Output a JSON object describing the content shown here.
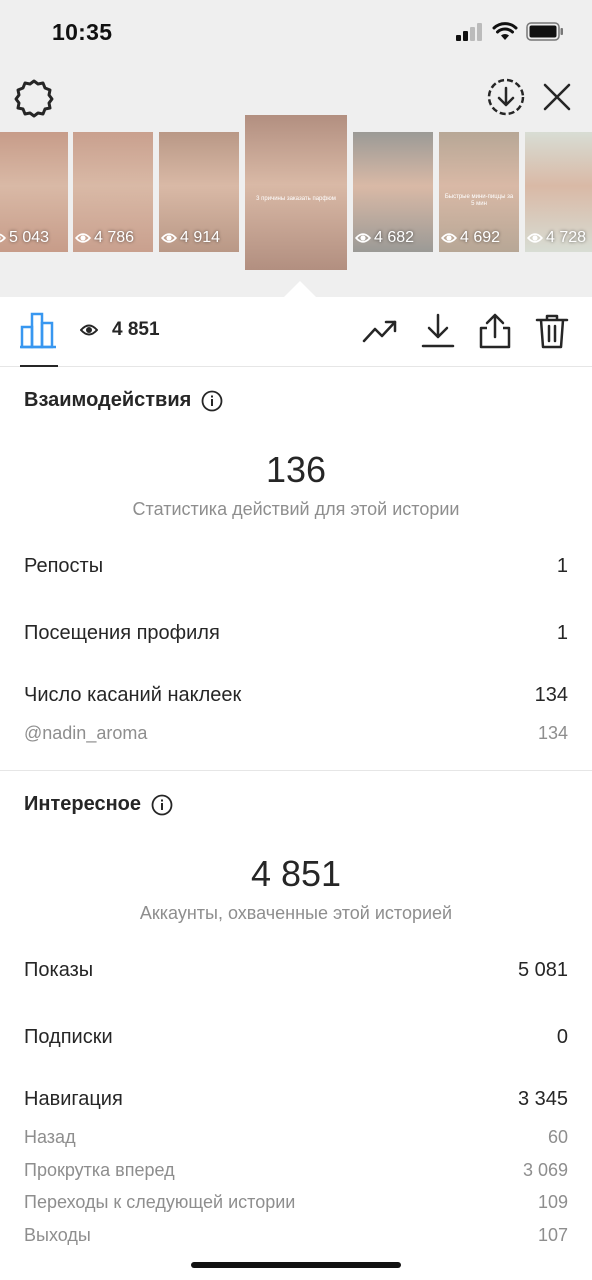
{
  "status_bar": {
    "time": "10:35"
  },
  "stories": [
    {
      "views": "5 043",
      "caption": "",
      "tint": "#c79c89"
    },
    {
      "views": "4 786",
      "caption": "",
      "tint": "#c9a08e"
    },
    {
      "views": "4 914",
      "caption": "",
      "tint": "#b99886"
    },
    {
      "views": "",
      "caption": "3 причины заказать парфюм",
      "tint": "#b28f80",
      "active": true
    },
    {
      "views": "4 682",
      "caption": "",
      "tint": "#9b9a96"
    },
    {
      "views": "4 692",
      "caption": "Быстрые мини-пиццы за 5 мин",
      "tint": "#b7a796"
    },
    {
      "views": "4 728",
      "caption": "",
      "tint": "#d8ddd4"
    }
  ],
  "toolbar": {
    "views": "4 851"
  },
  "interactions": {
    "title": "Взаимодействия",
    "total": "136",
    "subtitle": "Статистика действий для этой истории",
    "rows": [
      {
        "label": "Репосты",
        "value": "1"
      },
      {
        "label": "Посещения профиля",
        "value": "1"
      },
      {
        "label": "Число касаний наклеек",
        "value": "134"
      }
    ],
    "sub_rows": [
      {
        "label": "@nadin_aroma",
        "value": "134"
      }
    ]
  },
  "discovery": {
    "title": "Интересное",
    "total": "4 851",
    "subtitle": "Аккаунты, охваченные этой историей",
    "rows": [
      {
        "label": "Показы",
        "value": "5 081"
      },
      {
        "label": "Подписки",
        "value": "0"
      },
      {
        "label": "Навигация",
        "value": "3 345"
      }
    ],
    "sub_rows": [
      {
        "label": "Назад",
        "value": "60"
      },
      {
        "label": "Прокрутка вперед",
        "value": "3 069"
      },
      {
        "label": "Переходы к следующей истории",
        "value": "109"
      },
      {
        "label": "Выходы",
        "value": "107"
      }
    ]
  },
  "colors": {
    "accent": "#3897f0",
    "text": "#262626",
    "muted": "#8e8e8e",
    "header_bg": "#efefef"
  }
}
